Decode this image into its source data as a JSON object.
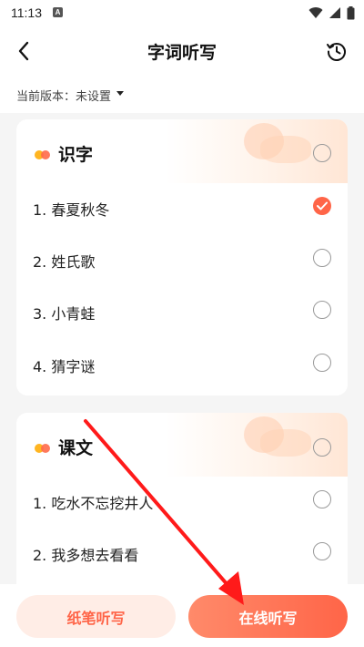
{
  "status_bar": {
    "time": "11:13",
    "notification_icon": "A",
    "icons": [
      "wifi-icon",
      "signal-icon",
      "battery-icon"
    ]
  },
  "header": {
    "title": "字词听写",
    "back_icon": "chevron-left-icon",
    "history_icon": "history-clock-icon"
  },
  "version": {
    "label": "当前版本：未设置"
  },
  "sections": [
    {
      "title": "识字",
      "items": [
        {
          "label": "1. 春夏秋冬",
          "checked": true
        },
        {
          "label": "2. 姓氏歌",
          "checked": false
        },
        {
          "label": "3. 小青蛙",
          "checked": false
        },
        {
          "label": "4. 猜字谜",
          "checked": false
        }
      ]
    },
    {
      "title": "课文",
      "items": [
        {
          "label": "1. 吃水不忘挖井人",
          "checked": false
        },
        {
          "label": "2. 我多想去看看",
          "checked": false
        }
      ]
    }
  ],
  "buttons": {
    "paper": "纸笔听写",
    "online": "在线听写"
  },
  "colors": {
    "accent": "#ff6548",
    "annotation_arrow": "#ff1a1a"
  }
}
